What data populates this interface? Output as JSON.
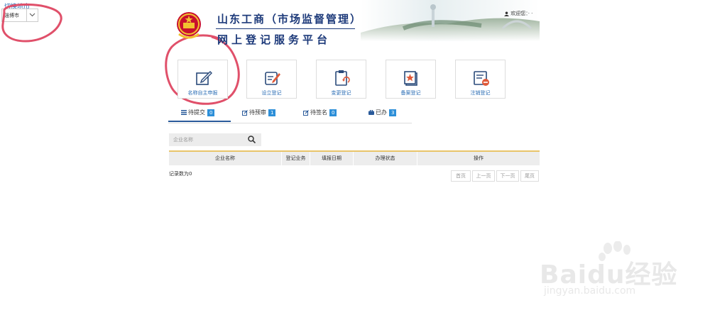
{
  "city": {
    "label": "切换地市",
    "selected": "淄博市"
  },
  "header": {
    "title_line1": "山东工商（市场监督管理）",
    "title_line2": "网上登记服务平台",
    "welcome": "欢迎您：· ·"
  },
  "services": [
    {
      "label": "名称自主申报",
      "icon": "name-declare-icon"
    },
    {
      "label": "设立登记",
      "icon": "establish-icon"
    },
    {
      "label": "变更登记",
      "icon": "change-icon"
    },
    {
      "label": "备案登记",
      "icon": "filing-icon"
    },
    {
      "label": "注销登记",
      "icon": "cancel-icon"
    }
  ],
  "tabs": [
    {
      "label": "待提交",
      "count": "0",
      "icon": "list-icon"
    },
    {
      "label": "待预审",
      "count": "1",
      "icon": "edit-icon"
    },
    {
      "label": "待签名",
      "count": "0",
      "icon": "edit-icon"
    },
    {
      "label": "已办",
      "count": "3",
      "icon": "briefcase-icon"
    }
  ],
  "search": {
    "placeholder": "企业名称"
  },
  "table": {
    "columns": [
      "企业名称",
      "登记业务",
      "填报日期",
      "办理状态",
      "操作"
    ],
    "record_count": "记录数为0"
  },
  "pager": {
    "first": "首页",
    "prev": "上一页",
    "next": "下一页",
    "last": "尾页"
  },
  "watermark": {
    "text1": "Baidu经验",
    "text2": "jingyan.baidu.com"
  },
  "colors": {
    "brand_blue": "#1d3a7a",
    "link_blue": "#2a6db5",
    "badge_blue": "#2d8fd8",
    "annotation_red": "#e0506a"
  }
}
